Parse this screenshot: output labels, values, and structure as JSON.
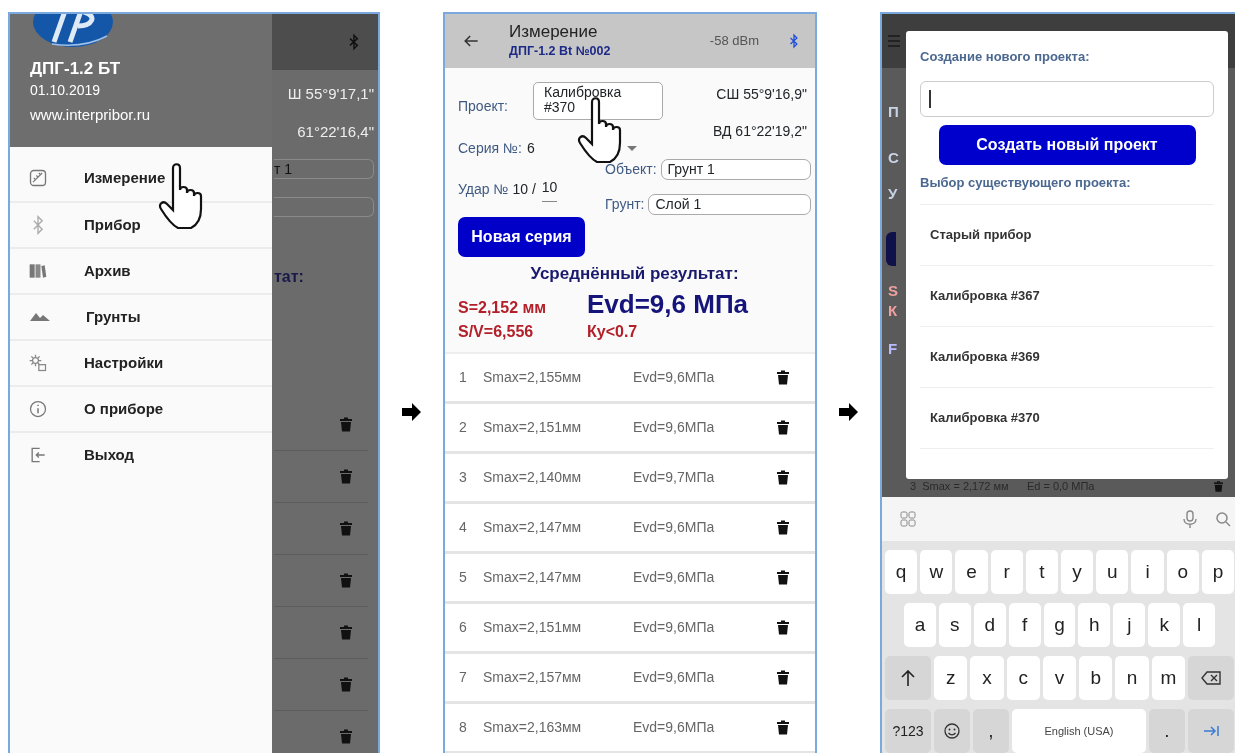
{
  "drawer_screen": {
    "background": {
      "latitude": "Ш 55°9'17,1\"",
      "longitude": "61°22'16,4\"",
      "object_field": "т 1",
      "result_label": "тат:"
    },
    "header": {
      "device": "ДПГ-1.2 БТ",
      "date": "01.10.2019",
      "website": "www.interpribor.ru"
    },
    "menu": [
      {
        "label": "Измерение"
      },
      {
        "label": "Прибор"
      },
      {
        "label": "Архив"
      },
      {
        "label": "Грунты"
      },
      {
        "label": "Настройки"
      },
      {
        "label": "О приборе"
      },
      {
        "label": "Выход"
      }
    ]
  },
  "measurement_screen": {
    "header": {
      "title": "Измерение",
      "subtitle": "ДПГ-1.2 Bt №002",
      "signal": "-58 dBm"
    },
    "form": {
      "project_label": "Проект:",
      "project_value": "Калибровка #370",
      "latitude": "СШ 55°9'16,9\"",
      "longitude": "ВД 61°22'19,2\"",
      "series_label": "Серия №:",
      "series_value": "6",
      "object_label": "Объект:",
      "object_value": "Грунт 1",
      "strike_label": "Удар №",
      "strike_value": "10 /",
      "strike_total": "10",
      "soil_label": "Грунт:",
      "soil_value": "Слой 1"
    },
    "new_series_button": "Новая серия",
    "result": {
      "title": "Усреднённый результат:",
      "settlement": "S=2,152 мм",
      "modulus": "Evd=9,6 МПа",
      "ratio": "S/V=6,556",
      "ky": "Ку<0.7"
    },
    "rows": [
      {
        "n": "1",
        "smax": "Smax=2,155мм",
        "evd": "Evd=9,6МПа"
      },
      {
        "n": "2",
        "smax": "Smax=2,151мм",
        "evd": "Evd=9,6МПа"
      },
      {
        "n": "3",
        "smax": "Smax=2,140мм",
        "evd": "Evd=9,7МПа"
      },
      {
        "n": "4",
        "smax": "Smax=2,147мм",
        "evd": "Evd=9,6МПа"
      },
      {
        "n": "5",
        "smax": "Smax=2,147мм",
        "evd": "Evd=9,6МПа"
      },
      {
        "n": "6",
        "smax": "Smax=2,151мм",
        "evd": "Evd=9,6МПа"
      },
      {
        "n": "7",
        "smax": "Smax=2,157мм",
        "evd": "Evd=9,6МПа"
      },
      {
        "n": "8",
        "smax": "Smax=2,163мм",
        "evd": "Evd=9,6МПа"
      }
    ]
  },
  "project_dialog_screen": {
    "background": {
      "fragments": [
        "П",
        "С",
        "У",
        "S",
        "К",
        "F"
      ],
      "row": "3  Smax = 2,172 мм      Ed = 0,0 МПа"
    },
    "dialog": {
      "create_title": "Создание нового проекта:",
      "create_button": "Создать новый проект",
      "choose_title": "Выбор существующего проекта:",
      "projects": [
        "Старый прибор",
        "Калибровка #367",
        "Калибровка #369",
        "Калибровка #370"
      ]
    },
    "keyboard": {
      "letter_rows": [
        [
          "q",
          "w",
          "e",
          "r",
          "t",
          "y",
          "u",
          "i",
          "o",
          "p"
        ],
        [
          "a",
          "s",
          "d",
          "f",
          "g",
          "h",
          "j",
          "k",
          "l"
        ],
        [
          "z",
          "x",
          "c",
          "v",
          "b",
          "n",
          "m"
        ]
      ],
      "symbols_key": "?123",
      "comma_key": ",",
      "space_key": "English (USA)",
      "period_key": "."
    }
  }
}
